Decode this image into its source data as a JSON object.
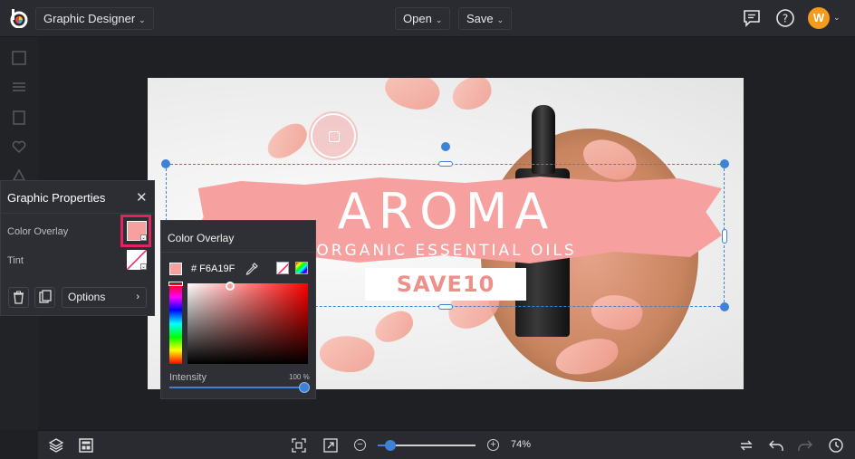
{
  "topbar": {
    "app_mode": "Graphic Designer",
    "open_label": "Open",
    "save_label": "Save",
    "avatar_initial": "W",
    "avatar_color": "#f29b1d"
  },
  "canvas": {
    "headline": "AROMA",
    "subheadline": "ORGANIC ESSENTIAL OILS",
    "promo_code": "SAVE10",
    "brush_color": "#f6a19f"
  },
  "graphic_properties": {
    "title": "Graphic Properties",
    "color_overlay_label": "Color Overlay",
    "tint_label": "Tint",
    "options_label": "Options"
  },
  "color_overlay": {
    "title": "Color Overlay",
    "hex_value": "# F6A19F",
    "color": "#f6a19f",
    "intensity_label": "Intensity",
    "intensity_value": "100 %",
    "intensity_fraction": 1.0
  },
  "bottombar": {
    "zoom_text": "74%",
    "zoom_fraction": 0.08
  },
  "icons": [
    "chat-icon",
    "help-icon",
    "layers-icon",
    "layout-icon",
    "fit-screen-icon",
    "expand-icon",
    "zoom-out-icon",
    "zoom-in-icon",
    "swap-icon",
    "undo-icon",
    "redo-icon",
    "history-icon",
    "trash-icon",
    "duplicate-icon",
    "eyedropper-icon",
    "close-icon"
  ]
}
